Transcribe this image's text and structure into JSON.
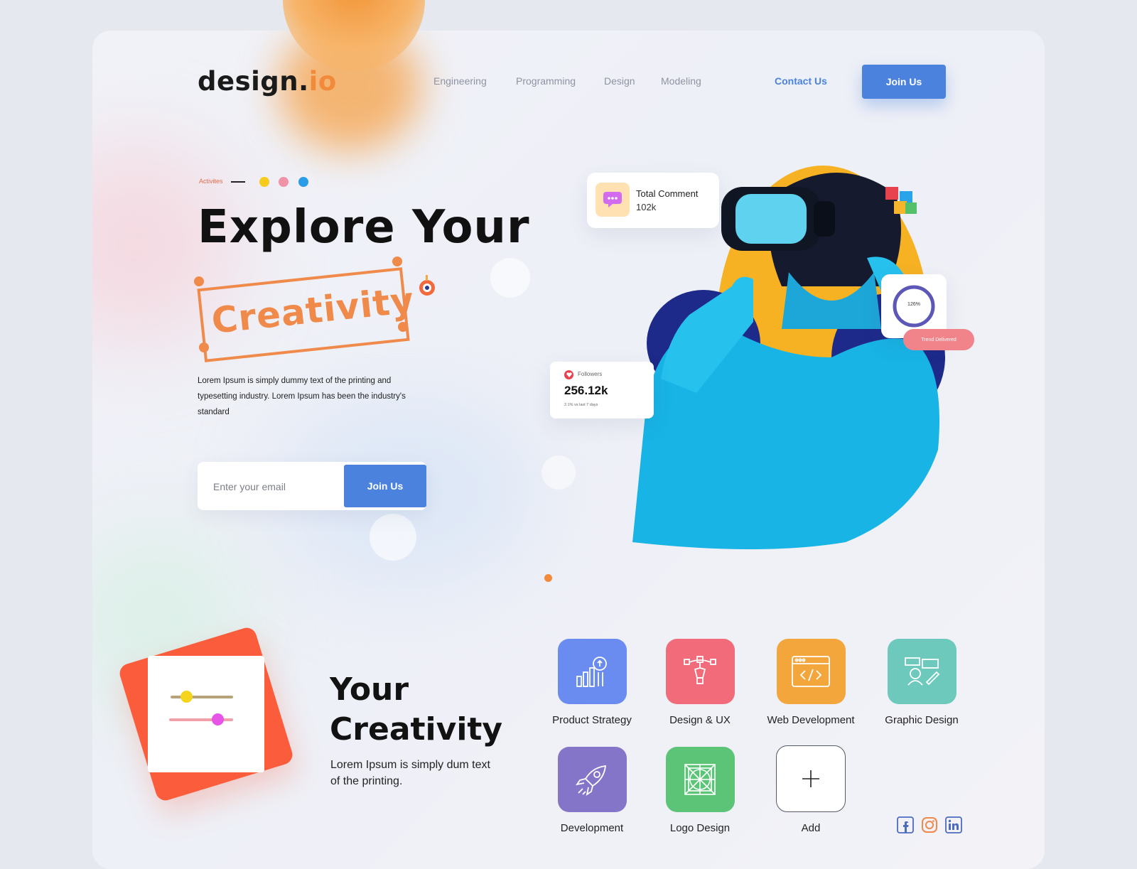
{
  "brand": {
    "name": "design.",
    "suffix": "io"
  },
  "nav": {
    "items": [
      "Engineering",
      "Programming",
      "Design",
      "Modeling"
    ],
    "contact": "Contact Us",
    "join": "Join Us"
  },
  "hero": {
    "activities": "Activites",
    "dot_colors": [
      "#f5cc1c",
      "#f093a8",
      "#2a9de8"
    ],
    "title_line1": "Explore Your",
    "title_line2": "Creativity",
    "description": "Lorem Ipsum is simply dummy text of the printing and typesetting industry. Lorem Ipsum has been the industry's standard",
    "email_placeholder": "Enter your email",
    "join": "Join Us"
  },
  "stats": {
    "comment": {
      "title": "Total Comment",
      "value": "102k",
      "icon": "chat-bubble-icon"
    },
    "followers": {
      "label": "Followers",
      "value": "256.12k",
      "note": "2.1% vs last 7 days",
      "icon": "heart-icon"
    },
    "trend": {
      "percent": "126%",
      "label": "Trend Delivered"
    }
  },
  "section": {
    "title_line1": "Your",
    "title_line2": "Creativity",
    "text": "Lorem Ipsum is simply dum text of the printing."
  },
  "services": [
    {
      "label": "Product Strategy",
      "color": "#6a8cf0",
      "icon": "chart-growth-icon"
    },
    {
      "label": "Design & UX",
      "color": "#f26b7a",
      "icon": "pen-tool-icon"
    },
    {
      "label": "Web Development",
      "color": "#f3a63c",
      "icon": "code-window-icon"
    },
    {
      "label": "Graphic Design",
      "color": "#6cc9bb",
      "icon": "design-board-icon"
    },
    {
      "label": "Development",
      "color": "#8575c8",
      "icon": "rocket-icon"
    },
    {
      "label": "Logo Design",
      "color": "#5cc477",
      "icon": "logo-grid-icon"
    },
    {
      "label": "Add",
      "color": "#ffffff",
      "icon": "plus-icon"
    }
  ],
  "social": [
    "facebook-icon",
    "instagram-icon",
    "linkedin-icon"
  ]
}
